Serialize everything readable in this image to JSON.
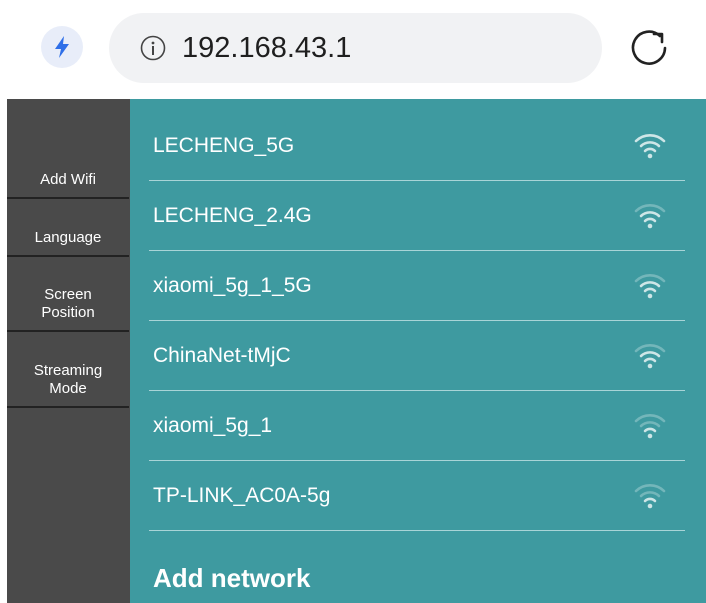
{
  "browser": {
    "url": "192.168.43.1",
    "icons": {
      "left": "lightning-bolt-icon",
      "site_info": "info-icon",
      "reload": "reload-icon"
    },
    "colors": {
      "bolt": "#2f6fe8",
      "bar_bg": "#f1f2f4"
    }
  },
  "sidebar": {
    "items": [
      {
        "label": "Add Wifi"
      },
      {
        "label": "Language"
      },
      {
        "label": "Screen\nPosition"
      },
      {
        "label": "Streaming\nMode"
      }
    ]
  },
  "networks": [
    {
      "name": "LECHENG_5G",
      "signal_bars": 4
    },
    {
      "name": "LECHENG_2.4G",
      "signal_bars": 3
    },
    {
      "name": "xiaomi_5g_1_5G",
      "signal_bars": 3
    },
    {
      "name": "ChinaNet-tMjC",
      "signal_bars": 3
    },
    {
      "name": "xiaomi_5g_1",
      "signal_bars": 2
    },
    {
      "name": "TP-LINK_AC0A-5g",
      "signal_bars": 2
    }
  ],
  "add_network_label": "Add network",
  "colors": {
    "sidebar": "#4a4a4a",
    "main": "#3e9aa0",
    "divider": "#a9d4d7"
  }
}
